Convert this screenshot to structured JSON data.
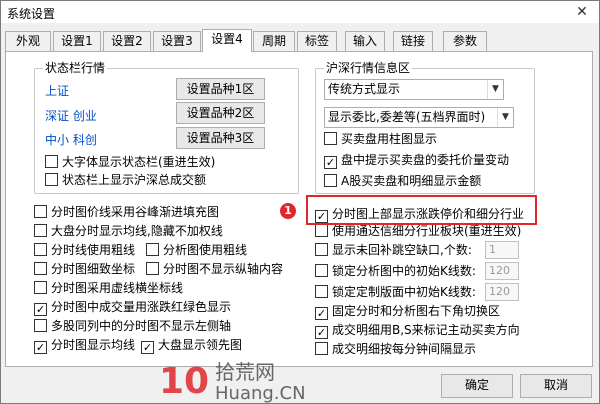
{
  "window": {
    "title": "系统设置",
    "close_glyph": "✕"
  },
  "tabs": [
    {
      "label": "外观"
    },
    {
      "label": "设置1"
    },
    {
      "label": "设置2"
    },
    {
      "label": "设置3"
    },
    {
      "label": "设置4",
      "active": true
    },
    {
      "label": "周期"
    },
    {
      "label": "标签"
    },
    {
      "label": "输入"
    },
    {
      "label": "链接"
    },
    {
      "label": "参数"
    }
  ],
  "status_group": {
    "title": "状态栏行情",
    "rows": [
      {
        "label": "上证",
        "button": "设置品种1区"
      },
      {
        "label": "深证 创业",
        "button": "设置品种2区"
      },
      {
        "label": "中小 科创",
        "button": "设置品种3区"
      }
    ],
    "checks": [
      {
        "label": "大字体显示状态栏(重进生效)",
        "checked": false
      },
      {
        "label": "状态栏上显示沪深总成交额",
        "checked": false
      }
    ]
  },
  "market_group": {
    "title": "沪深行情信息区",
    "select1": "传统方式显示",
    "select2": "显示委比,委差等(五档界面时)",
    "checks": [
      {
        "label": "买卖盘用柱图显示",
        "checked": false
      },
      {
        "label": "盘中提示买卖盘的委托价量变动",
        "checked": true
      },
      {
        "label": "A股买卖盘和明细显示金额",
        "checked": false
      }
    ]
  },
  "left_checks": [
    {
      "label": "分时图价线采用谷峰渐进填充图",
      "checked": false
    },
    {
      "label": "大盘分时显示均线,隐藏不加权线",
      "checked": false
    },
    {
      "label": "分时线使用粗线",
      "checked": false
    },
    {
      "label": "分析图使用粗线",
      "checked": false
    },
    {
      "label": "分时图细致坐标",
      "checked": false
    },
    {
      "label": "分时图不显示纵轴内容",
      "checked": false
    },
    {
      "label": "分时图采用虚线横坐标线",
      "checked": false
    },
    {
      "label": "分时图中成交量用涨跌红绿色显示",
      "checked": true
    },
    {
      "label": "多股同列中的分时图不显示左侧轴",
      "checked": false
    },
    {
      "label": "分时图显示均线",
      "checked": true
    },
    {
      "label": "大盘显示领先图",
      "checked": true
    }
  ],
  "right_checks": [
    {
      "label": "分时图上部显示涨跌停价和细分行业",
      "checked": true
    },
    {
      "label": "使用通达信细分行业板块(重进生效)",
      "checked": false
    },
    {
      "label": "显示未回补跳空缺口,个数:",
      "checked": false,
      "value": "1"
    },
    {
      "label": "锁定分析图中的初始K线数:",
      "checked": false,
      "value": "120"
    },
    {
      "label": "锁定定制版面中初始K线数:",
      "checked": false,
      "value": "120"
    },
    {
      "label": "固定分时和分析图右下角切换区",
      "checked": true
    },
    {
      "label": "成交明细用B,S来标记主动买卖方向",
      "checked": true
    },
    {
      "label": "成交明细按每分钟间隔显示",
      "checked": false
    }
  ],
  "annotation": {
    "badge": "1"
  },
  "buttons": {
    "ok": "确定",
    "cancel": "取消"
  },
  "watermark": {
    "line1": "拾荒网",
    "line2": "Huang.CN",
    "digits": "10"
  },
  "colors": {
    "highlight": "#e0282c",
    "label_blue": "#0050c8"
  }
}
